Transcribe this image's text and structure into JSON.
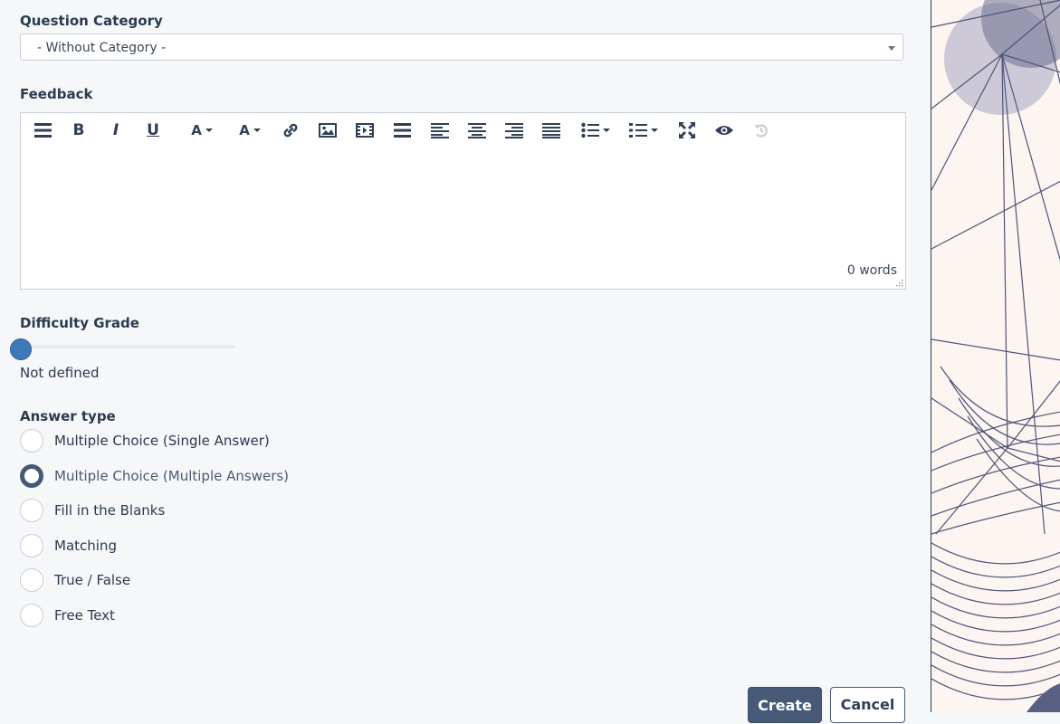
{
  "form": {
    "category_label": "Question Category",
    "category_value": "- Without Category -",
    "feedback_label": "Feedback",
    "word_count": "0 words",
    "difficulty_label": "Difficulty Grade",
    "difficulty_value_text": "Not defined",
    "difficulty_value": 0,
    "answer_type_label": "Answer type",
    "answer_types": [
      {
        "label": "Multiple Choice (Single Answer)",
        "selected": false
      },
      {
        "label": "Multiple Choice (Multiple Answers)",
        "selected": true
      },
      {
        "label": "Fill in the Blanks",
        "selected": false
      },
      {
        "label": "Matching",
        "selected": false
      },
      {
        "label": "True / False",
        "selected": false
      },
      {
        "label": "Free Text",
        "selected": false
      }
    ]
  },
  "toolbar": {
    "icons": [
      "menu-icon",
      "bold-icon",
      "italic-icon",
      "underline-icon",
      "font-color-icon",
      "font-size-icon",
      "link-icon",
      "image-icon",
      "video-icon",
      "paragraph-icon",
      "align-left-icon",
      "align-center-icon",
      "align-right-icon",
      "align-justify-icon",
      "unordered-list-icon",
      "ordered-list-icon",
      "fullscreen-icon",
      "preview-icon",
      "undo-icon"
    ],
    "bold_glyph": "B",
    "italic_glyph": "I",
    "underline_glyph": "U",
    "font_glyph": "A"
  },
  "actions": {
    "create_label": "Create",
    "cancel_label": "Cancel"
  },
  "colors": {
    "accent": "#465a78",
    "slider": "#3f79b5",
    "background": "#f6f7f9"
  }
}
